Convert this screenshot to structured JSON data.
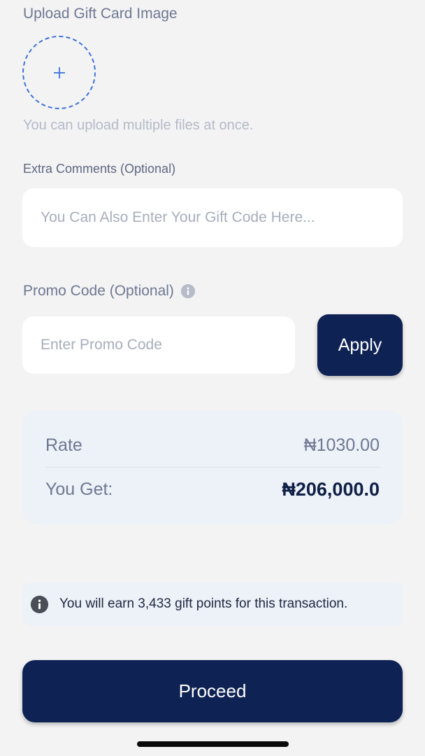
{
  "upload": {
    "title": "Upload Gift Card Image",
    "add_icon": "plus-icon",
    "hint": "You can upload multiple files at once."
  },
  "comments": {
    "label": "Extra Comments (Optional)",
    "placeholder": "You Can Also Enter Your Gift Code Here...",
    "value": ""
  },
  "promo": {
    "label": "Promo Code (Optional)",
    "info_icon": "info-icon",
    "placeholder": "Enter Promo Code",
    "value": "",
    "apply_label": "Apply"
  },
  "summary": {
    "rate_label": "Rate",
    "rate_value": "₦1030.00",
    "get_label": "You Get:",
    "get_value": "₦206,000.0"
  },
  "notice": {
    "icon": "info-icon",
    "text": "You will earn 3,433 gift points for this transaction."
  },
  "actions": {
    "proceed_label": "Proceed"
  },
  "colors": {
    "primary": "#0e2253",
    "background": "#f3f3f4",
    "upload_accent": "#3d73d8",
    "card_background": "#edf1f8"
  }
}
